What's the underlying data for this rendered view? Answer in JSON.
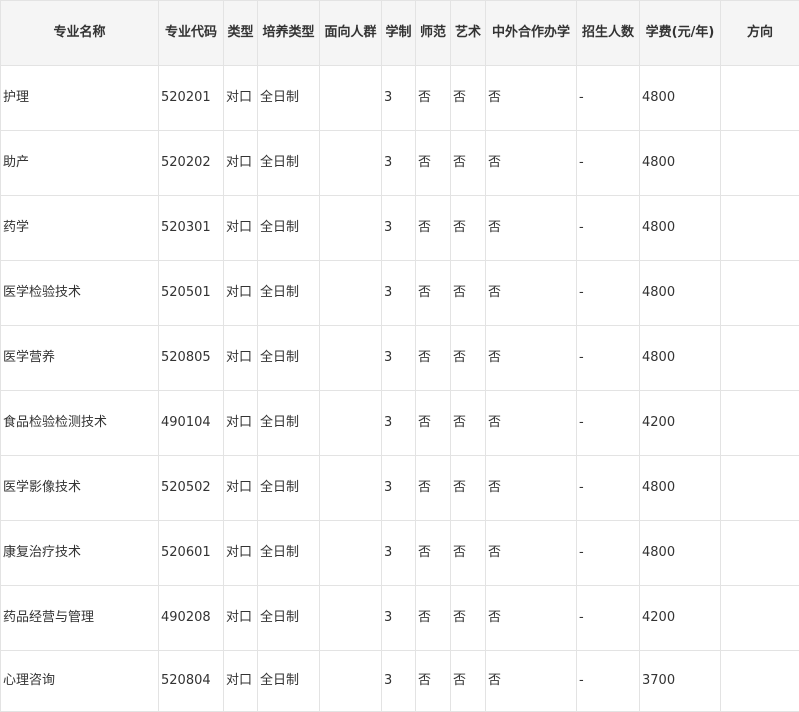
{
  "table": {
    "headers": [
      "专业名称",
      "专业代码",
      "类型",
      "培养类型",
      "面向人群",
      "学制",
      "师范",
      "艺术",
      "中外合作办学",
      "招生人数",
      "学费(元/年)",
      "方向"
    ],
    "rows": [
      {
        "name": "护理",
        "code": "520201",
        "type": "对口",
        "training": "全日制",
        "audience": "",
        "years": "3",
        "normal": "否",
        "art": "否",
        "coop": "否",
        "enroll": "-",
        "fee": "4800",
        "direction": ""
      },
      {
        "name": "助产",
        "code": "520202",
        "type": "对口",
        "training": "全日制",
        "audience": "",
        "years": "3",
        "normal": "否",
        "art": "否",
        "coop": "否",
        "enroll": "-",
        "fee": "4800",
        "direction": ""
      },
      {
        "name": "药学",
        "code": "520301",
        "type": "对口",
        "training": "全日制",
        "audience": "",
        "years": "3",
        "normal": "否",
        "art": "否",
        "coop": "否",
        "enroll": "-",
        "fee": "4800",
        "direction": ""
      },
      {
        "name": "医学检验技术",
        "code": "520501",
        "type": "对口",
        "training": "全日制",
        "audience": "",
        "years": "3",
        "normal": "否",
        "art": "否",
        "coop": "否",
        "enroll": "-",
        "fee": "4800",
        "direction": ""
      },
      {
        "name": "医学营养",
        "code": "520805",
        "type": "对口",
        "training": "全日制",
        "audience": "",
        "years": "3",
        "normal": "否",
        "art": "否",
        "coop": "否",
        "enroll": "-",
        "fee": "4800",
        "direction": ""
      },
      {
        "name": "食品检验检测技术",
        "code": "490104",
        "type": "对口",
        "training": "全日制",
        "audience": "",
        "years": "3",
        "normal": "否",
        "art": "否",
        "coop": "否",
        "enroll": "-",
        "fee": "4200",
        "direction": ""
      },
      {
        "name": "医学影像技术",
        "code": "520502",
        "type": "对口",
        "training": "全日制",
        "audience": "",
        "years": "3",
        "normal": "否",
        "art": "否",
        "coop": "否",
        "enroll": "-",
        "fee": "4800",
        "direction": ""
      },
      {
        "name": "康复治疗技术",
        "code": "520601",
        "type": "对口",
        "training": "全日制",
        "audience": "",
        "years": "3",
        "normal": "否",
        "art": "否",
        "coop": "否",
        "enroll": "-",
        "fee": "4800",
        "direction": ""
      },
      {
        "name": "药品经营与管理",
        "code": "490208",
        "type": "对口",
        "training": "全日制",
        "audience": "",
        "years": "3",
        "normal": "否",
        "art": "否",
        "coop": "否",
        "enroll": "-",
        "fee": "4200",
        "direction": ""
      },
      {
        "name": "心理咨询",
        "code": "520804",
        "type": "对口",
        "training": "全日制",
        "audience": "",
        "years": "3",
        "normal": "否",
        "art": "否",
        "coop": "否",
        "enroll": "-",
        "fee": "3700",
        "direction": ""
      }
    ]
  }
}
